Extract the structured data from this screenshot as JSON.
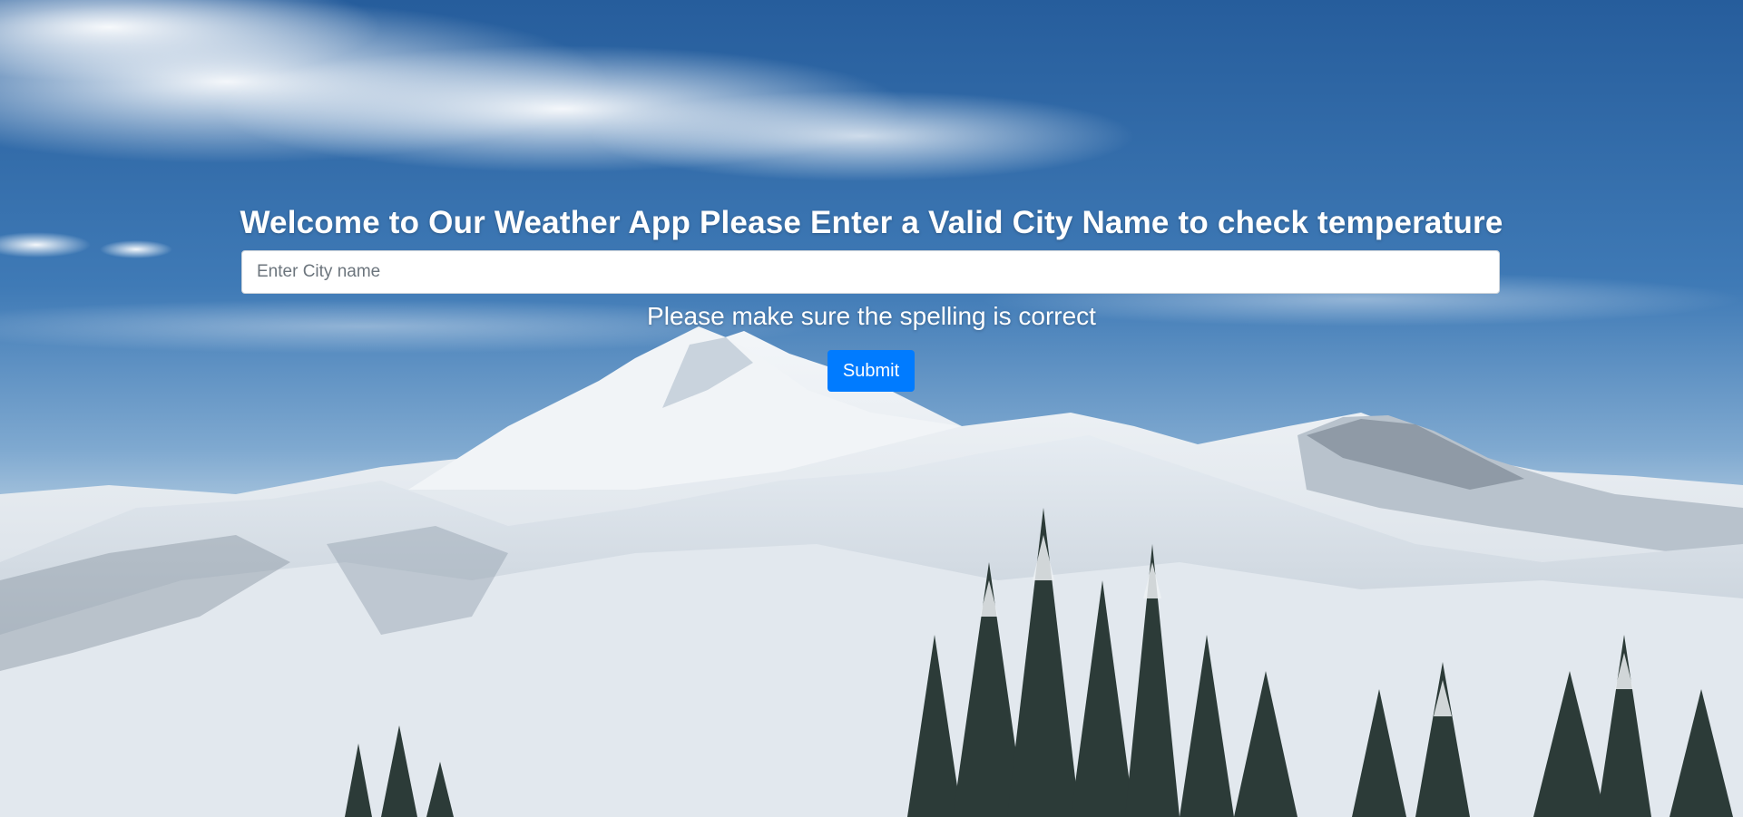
{
  "page": {
    "title": "Welcome to Our Weather App Please Enter a Valid City Name to check temperature",
    "hint": "Please make sure the spelling is correct"
  },
  "form": {
    "city_placeholder": "Enter City name",
    "city_value": "",
    "submit_label": "Submit"
  },
  "background": {
    "subject": "snowy-mountain-landscape",
    "colors": {
      "sky_top": "#2f6aa8",
      "sky_mid": "#5d93c4",
      "snow": "#e9eef3",
      "trees": "#2b3a36"
    }
  },
  "colors": {
    "primary_button": "#007bff",
    "text": "#ffffff"
  }
}
